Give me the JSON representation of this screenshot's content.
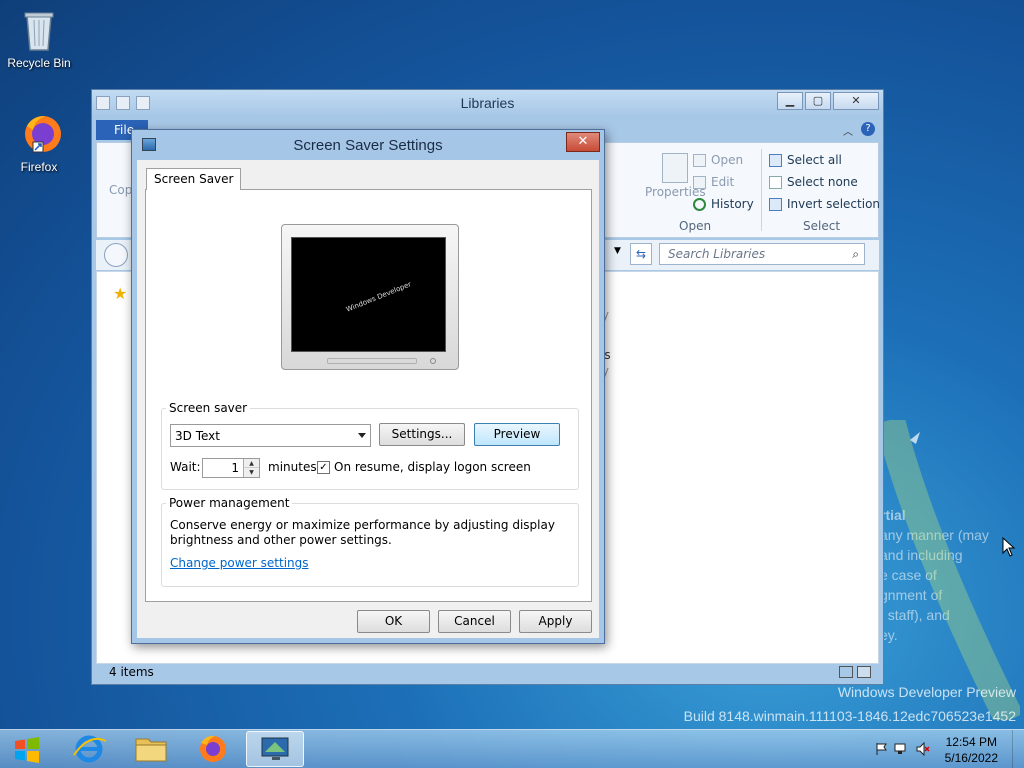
{
  "desktop": {
    "icons": [
      {
        "label": "Recycle Bin",
        "icon": "recycle-bin-icon"
      },
      {
        "label": "Firefox",
        "icon": "firefox-icon"
      }
    ],
    "watermark_line1": "Windows Developer Preview",
    "watermark_line2": "Build 8148.winmain.111103-1846.12edc706523e1452",
    "watermark_partial": [
      "rtial",
      "any manner (may",
      "and including",
      "e case of",
      "gnment of",
      "t staff), and",
      "ey."
    ]
  },
  "explorer": {
    "title": "Libraries",
    "file_tab": "File",
    "ribbon": {
      "copy_label": "Copy",
      "properties_label": "Properties",
      "open_label": "Open",
      "edit_label": "Edit",
      "history_label": "History",
      "open_group": "Open",
      "select_all": "Select all",
      "select_none": "Select none",
      "invert_selection": "Invert selection",
      "select_group": "Select"
    },
    "search_placeholder": "Search Libraries",
    "content_fragments": [
      "c",
      "ry",
      "os",
      "ry"
    ],
    "status_items": "4 items"
  },
  "dialog": {
    "title": "Screen Saver Settings",
    "tab_label": "Screen Saver",
    "preview_text": "Windows Developer",
    "screen_saver_group": "Screen saver",
    "selected_saver": "3D Text",
    "settings_button": "Settings...",
    "preview_button": "Preview",
    "wait_label": "Wait:",
    "wait_value": "1",
    "minutes_label": "minutes",
    "resume_checked": true,
    "resume_label": "On resume, display logon screen",
    "power_group": "Power management",
    "power_text_line1": "Conserve energy or maximize performance by adjusting display",
    "power_text_line2": "brightness and other power settings.",
    "power_link": "Change power settings",
    "ok_button": "OK",
    "cancel_button": "Cancel",
    "apply_button": "Apply"
  },
  "taskbar": {
    "clock_time": "12:54 PM",
    "clock_date": "5/16/2022"
  }
}
